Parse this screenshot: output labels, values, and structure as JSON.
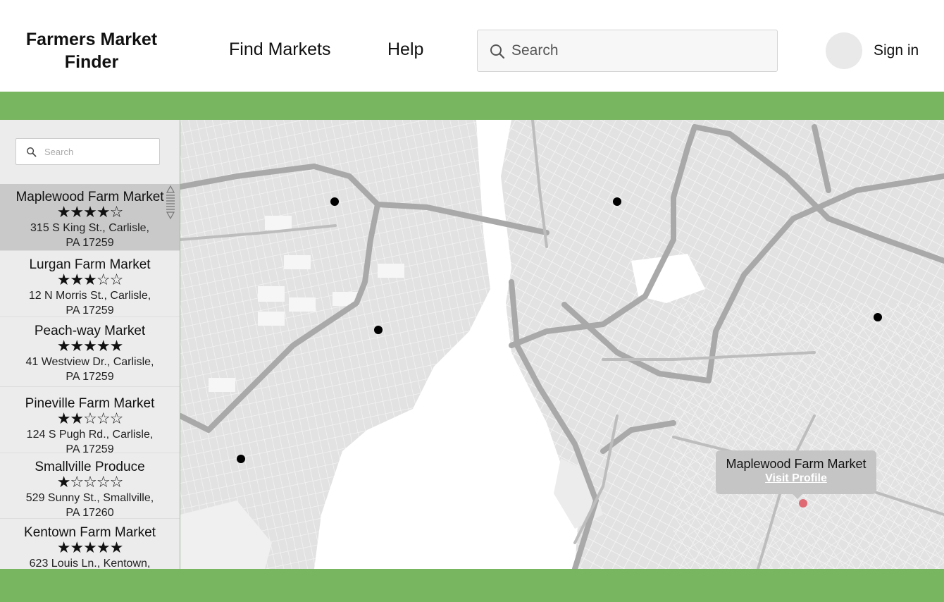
{
  "header": {
    "brand": "Farmers Market Finder",
    "nav": {
      "find_markets": "Find Markets",
      "help": "Help"
    },
    "search": {
      "placeholder": "Search",
      "icon": "search-icon"
    },
    "sign_in": "Sign in"
  },
  "sidebar": {
    "search": {
      "placeholder": "Search",
      "icon": "search-icon"
    },
    "markets": [
      {
        "name": "Maplewood Farm Market",
        "rating": 4,
        "stars": "★★★★☆",
        "address_line1": "315 S King St., Carlisle,",
        "address_line2": "PA 17259",
        "selected": true
      },
      {
        "name": "Lurgan Farm Market",
        "rating": 3,
        "stars": "★★★☆☆",
        "address_line1": "12 N Morris St., Carlisle,",
        "address_line2": "PA 17259",
        "selected": false
      },
      {
        "name": "Peach-way Market",
        "rating": 5,
        "stars": "★★★★★",
        "address_line1": "41 Westview Dr., Carlisle,",
        "address_line2": "PA 17259",
        "selected": false
      },
      {
        "name": "Pineville Farm Market",
        "rating": 2,
        "stars": "★★☆☆☆",
        "address_line1": "124 S Pugh Rd., Carlisle,",
        "address_line2": "PA 17259",
        "selected": false
      },
      {
        "name": "Smallville Produce",
        "rating": 1,
        "stars": "★☆☆☆☆",
        "address_line1": "529 Sunny St., Smallville,",
        "address_line2": "PA 17260",
        "selected": false
      },
      {
        "name": "Kentown Farm Market",
        "rating": 5,
        "stars": "★★★★★",
        "address_line1": "623 Louis Ln., Kentown,",
        "address_line2": "",
        "selected": false
      }
    ]
  },
  "map": {
    "popup": {
      "title": "Maplewood Farm Market",
      "link": "Visit Profile"
    },
    "selected_marker_color": "#e06a73",
    "marker_color": "#000000"
  },
  "colors": {
    "accent_green": "#78b65f",
    "selected_row": "#c9c9c9",
    "sidebar_bg": "#ececec"
  }
}
